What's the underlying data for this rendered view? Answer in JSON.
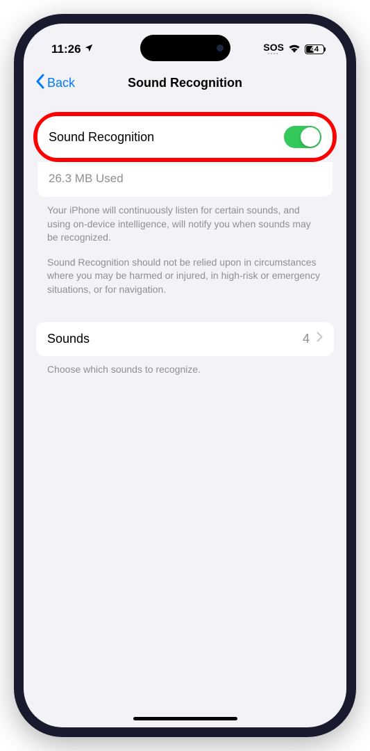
{
  "statusBar": {
    "time": "11:26",
    "sos": "SOS",
    "battery": "44"
  },
  "nav": {
    "back": "Back",
    "title": "Sound Recognition"
  },
  "mainToggle": {
    "label": "Sound Recognition",
    "storage": "26.3 MB Used"
  },
  "footer": {
    "desc1": "Your iPhone will continuously listen for certain sounds, and using on-device intelligence, will notify you when sounds may be recognized.",
    "desc2": "Sound Recognition should not be relied upon in circumstances where you may be harmed or injured, in high-risk or emergency situations, or for navigation."
  },
  "sounds": {
    "label": "Sounds",
    "count": "4",
    "footer": "Choose which sounds to recognize."
  }
}
